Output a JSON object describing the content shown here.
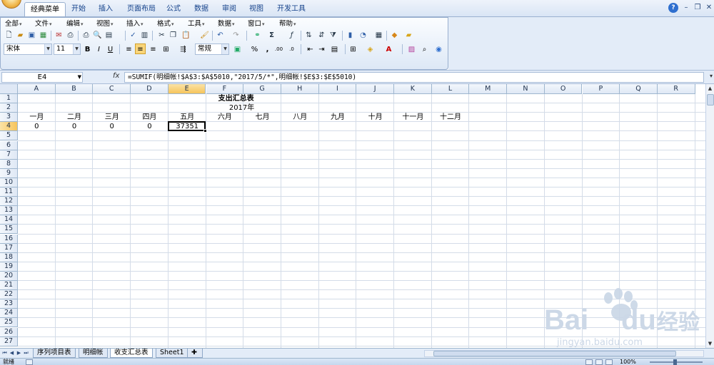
{
  "ribbon_tabs": [
    "经典菜单",
    "开始",
    "插入",
    "页面布局",
    "公式",
    "数据",
    "审阅",
    "视图",
    "开发工具"
  ],
  "active_tab_index": 0,
  "menus": [
    "全部",
    "文件",
    "编辑",
    "视图",
    "插入",
    "格式",
    "工具",
    "数据",
    "窗口",
    "帮助"
  ],
  "font": {
    "name": "宋体",
    "size": "11"
  },
  "format_buttons": {
    "bold": "B",
    "italic": "I",
    "underline": "U"
  },
  "number_format": "常规",
  "formula_bar": {
    "name_box": "E4",
    "fx": "fx",
    "formula": "=SUMIF(明细帐!$A$3:$A$5010,\"2017/5/*\",明细帐!$E$3:$E$5010)"
  },
  "columns": [
    "A",
    "B",
    "C",
    "D",
    "E",
    "F",
    "G",
    "H",
    "I",
    "J",
    "K",
    "L",
    "M",
    "N",
    "O",
    "P",
    "Q",
    "R"
  ],
  "selected_column": "E",
  "rows": [
    "1",
    "2",
    "3",
    "4",
    "5",
    "6",
    "7",
    "8",
    "9",
    "10",
    "11",
    "12",
    "13",
    "14",
    "15",
    "16",
    "17",
    "18",
    "19",
    "20",
    "21",
    "22",
    "23",
    "24",
    "25",
    "26",
    "27"
  ],
  "selected_row": "4",
  "sheet": {
    "title": "支出汇总表",
    "year": "2017年",
    "months": [
      "一月",
      "二月",
      "三月",
      "四月",
      "五月",
      "六月",
      "七月",
      "八月",
      "九月",
      "十月",
      "十一月",
      "十二月"
    ],
    "values": [
      "0",
      "0",
      "0",
      "0",
      "37351",
      "",
      "",
      "",
      "",
      "",
      "",
      ""
    ]
  },
  "sheet_tabs": [
    "序列项目表",
    "明细帐",
    "收支汇总表",
    "Sheet1"
  ],
  "active_sheet_index": 2,
  "status": {
    "mode": "就绪",
    "zoom": "100%"
  },
  "watermark": {
    "brand_latin": "Bai",
    "brand_tail": "du",
    "brand_cn": "经验",
    "url": "jingyan.baidu.com"
  }
}
